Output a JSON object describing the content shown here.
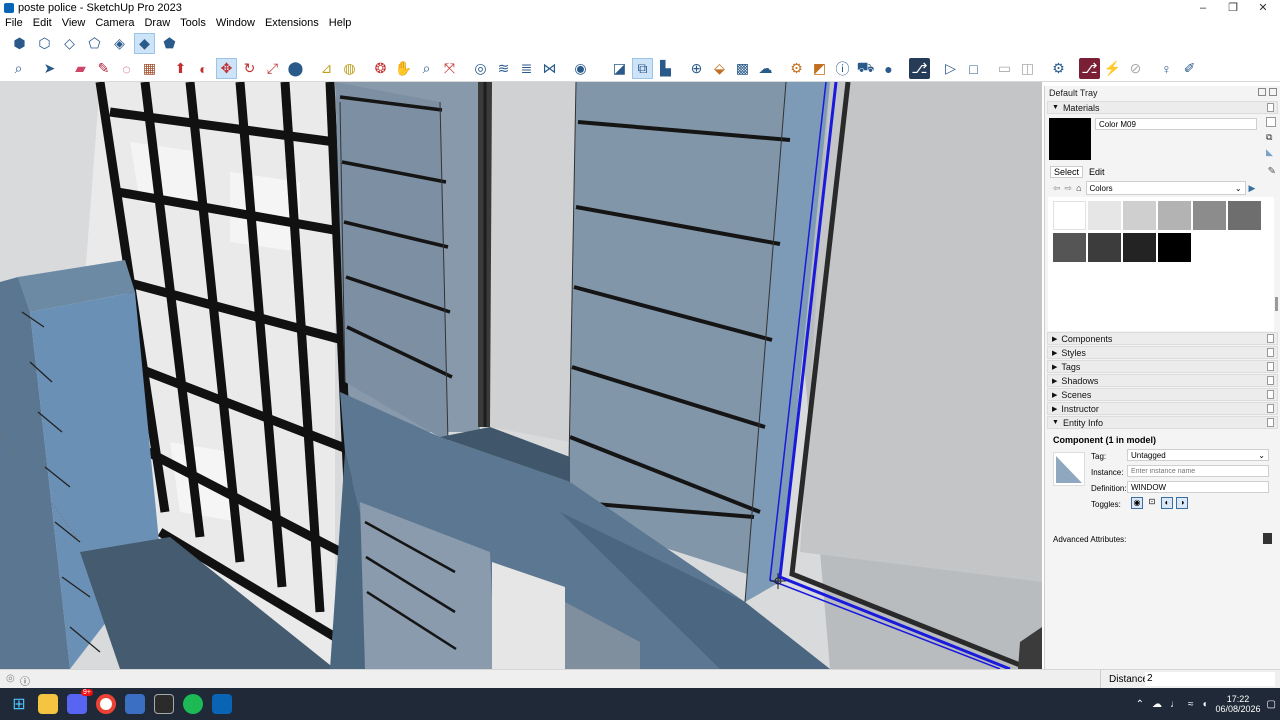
{
  "window": {
    "title": "poste police - SketchUp Pro 2023",
    "minimize": "–",
    "maximize": "❐",
    "close": "✕"
  },
  "menu": [
    "File",
    "Edit",
    "View",
    "Camera",
    "Draw",
    "Tools",
    "Window",
    "Extensions",
    "Help"
  ],
  "tray": {
    "title": "Default Tray",
    "materials": {
      "header": "Materials",
      "current_name": "Color M09",
      "current_color": "#000000",
      "tab_select": "Select",
      "tab_edit": "Edit",
      "collection": "Colors",
      "swatches_row1": [
        "#ffffff",
        "#e6e6e6",
        "#cfcfcf",
        "#b3b3b3",
        "#8c8c8c",
        "#6e6e6e"
      ],
      "swatches_row2": [
        "#555555",
        "#3c3c3c",
        "#232323",
        "#000000"
      ]
    },
    "sections": [
      "Components",
      "Styles",
      "Tags",
      "Shadows",
      "Scenes",
      "Instructor"
    ],
    "entity_info": {
      "header": "Entity Info",
      "title": "Component (1 in model)",
      "tag_label": "Tag:",
      "tag_value": "Untagged",
      "instance_label": "Instance:",
      "instance_placeholder": "Enter instance name",
      "definition_label": "Definition:",
      "definition_value": "WINDOW",
      "toggles_label": "Toggles:",
      "advanced": "Advanced Attributes:"
    }
  },
  "status": {
    "measure_label": "Distance",
    "measure_value": "2"
  },
  "taskbar": {
    "time": "17:22",
    "date": "06/08/2026",
    "discord_badge": "9+"
  },
  "colors": {
    "brand": "#0a64b5",
    "selection": "#1a1adc",
    "taskbar": "#1f2937"
  }
}
